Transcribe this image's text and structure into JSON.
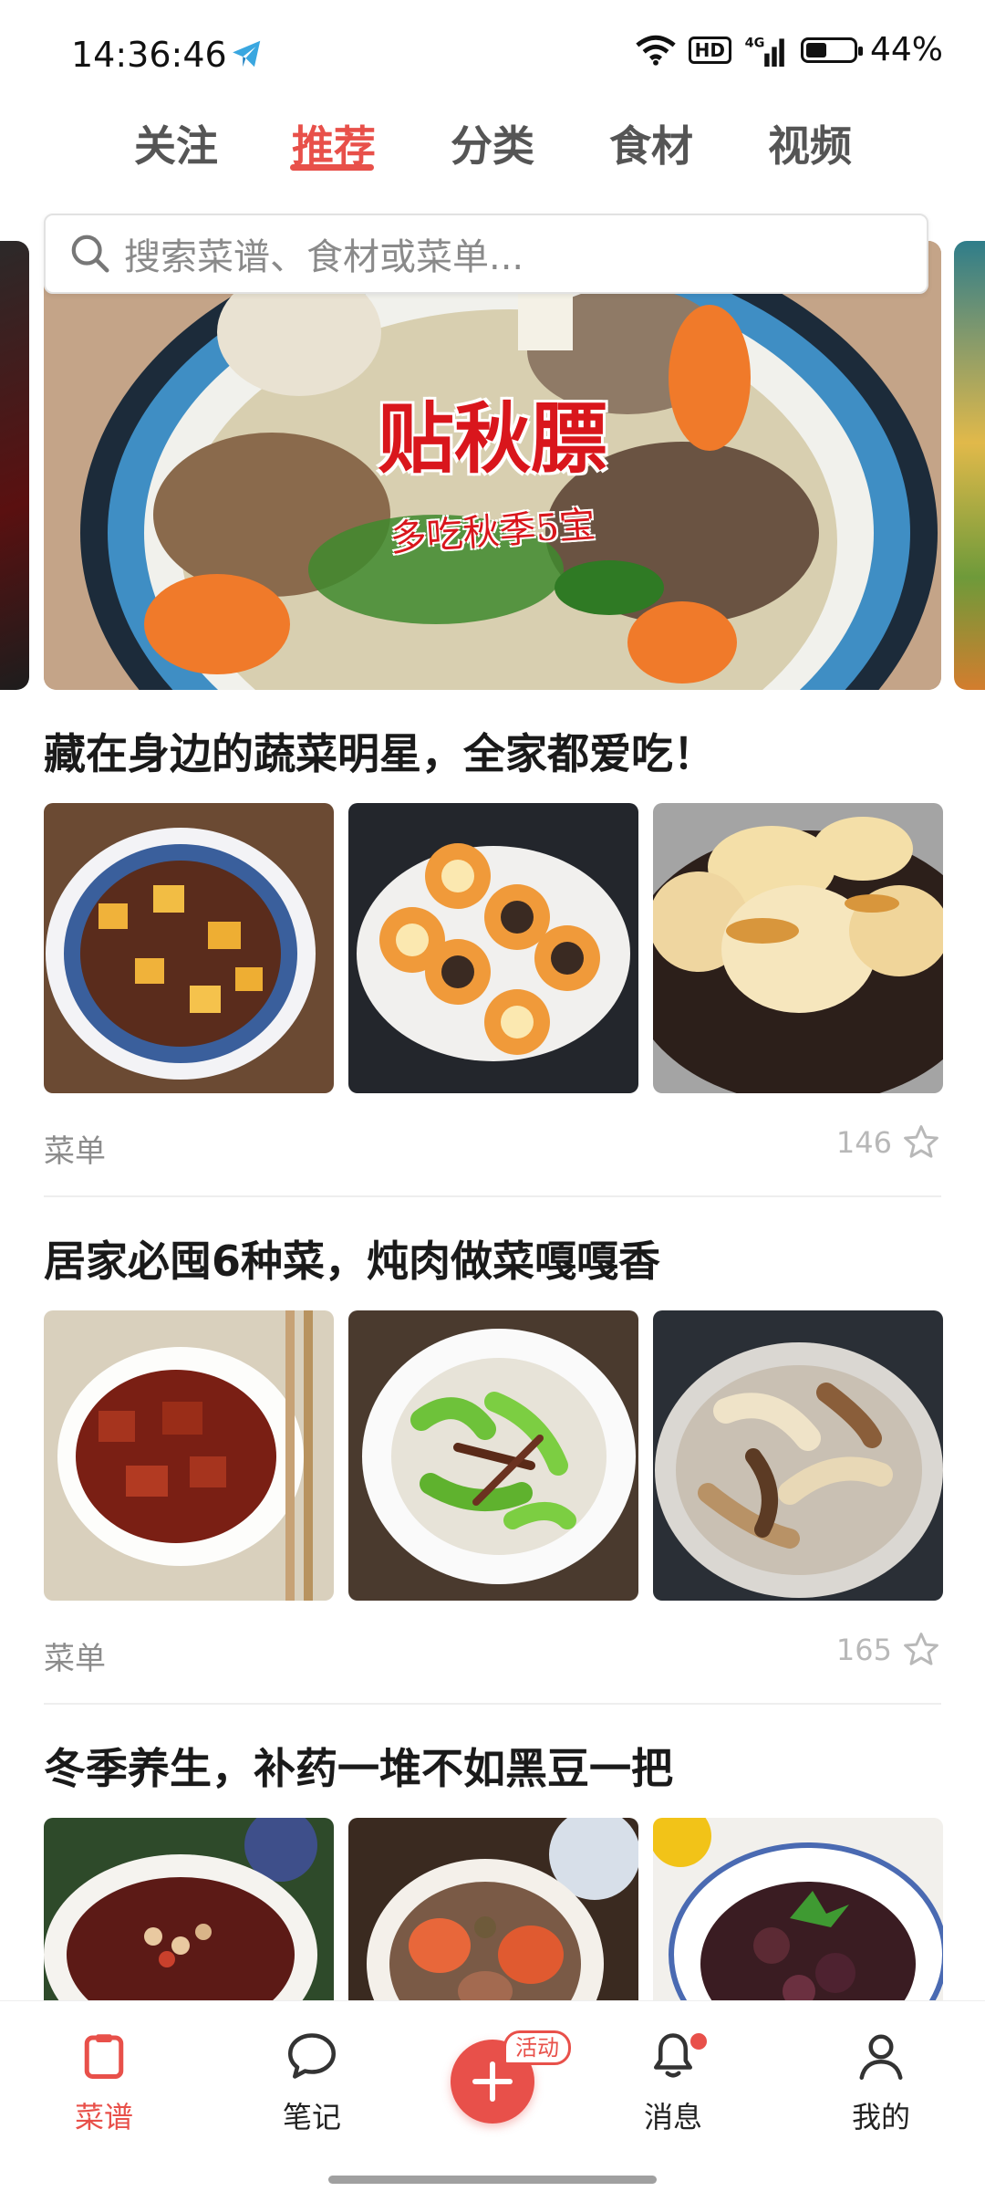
{
  "status_bar": {
    "time": "14:36:46",
    "network": "HD",
    "signal": "4G",
    "battery": "44%",
    "battery_level": 0.44
  },
  "top_tabs": [
    {
      "label": "关注",
      "active": false
    },
    {
      "label": "推荐",
      "active": true
    },
    {
      "label": "分类",
      "active": false
    },
    {
      "label": "食材",
      "active": false
    },
    {
      "label": "视频",
      "active": false
    }
  ],
  "search": {
    "placeholder": "搜索菜谱、食材或菜单..."
  },
  "banner": {
    "title": "贴秋膘",
    "subtitle": "多吃秋季5宝"
  },
  "sections": [
    {
      "title": "藏在身边的蔬菜明星，全家都爱吃！",
      "type_label": "菜单",
      "favorites": "146",
      "thumbnails": [
        "braised-pork-potato",
        "egg-pancakes",
        "pan-fried-dumplings"
      ]
    },
    {
      "title": "居家必囤6种菜，炖肉做菜嘎嘎香",
      "type_label": "菜单",
      "favorites": "165",
      "thumbnails": [
        "braised-pork-bamboo",
        "stir-fried-peppers",
        "stir-fried-mushrooms"
      ]
    },
    {
      "title": "冬季养生，补药一堆不如黑豆一把",
      "thumbnails": [
        "black-bean-porridge",
        "carrot-stew",
        "braised-black-beans"
      ]
    }
  ],
  "bottom_nav": {
    "items": [
      {
        "label": "菜谱",
        "icon": "recipe-clipboard-icon",
        "active": true
      },
      {
        "label": "笔记",
        "icon": "chat-bubble-icon",
        "active": false
      },
      {
        "label": "",
        "icon": "plus-icon",
        "active": false
      },
      {
        "label": "消息",
        "icon": "bell-icon",
        "active": false
      },
      {
        "label": "我的",
        "icon": "person-icon",
        "active": false
      }
    ],
    "activity_badge": "活动"
  },
  "colors": {
    "accent": "#e8504a",
    "muted_text": "#8c8c8c"
  }
}
